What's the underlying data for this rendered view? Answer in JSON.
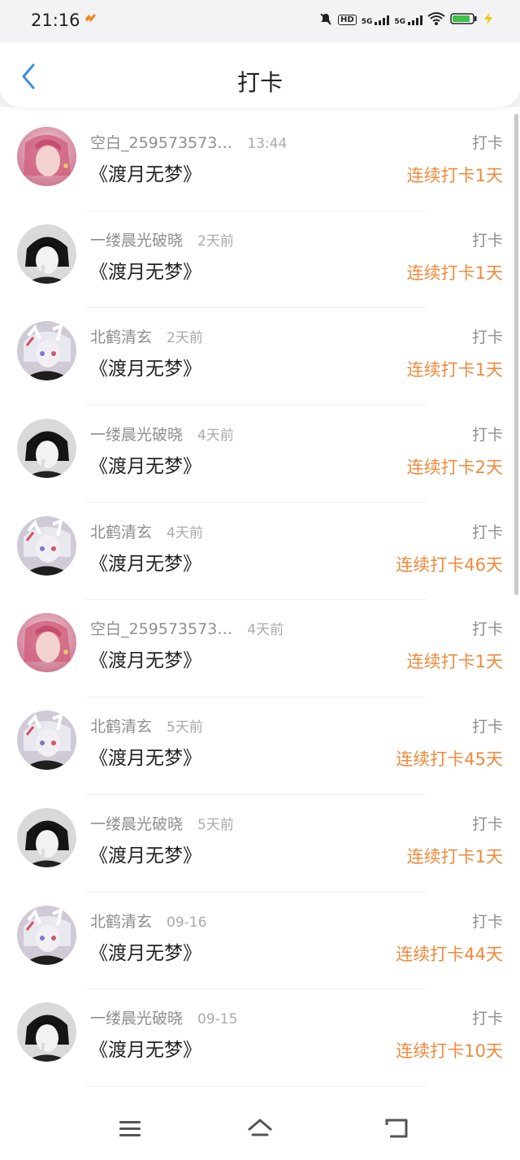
{
  "status_bar": {
    "time": "21:16",
    "network_label": "HD",
    "signal_1": "5G",
    "signal_2": "5G"
  },
  "header": {
    "title": "打卡",
    "back_icon": "chevron-left-icon"
  },
  "items": [
    {
      "name": "空白_259573573…",
      "time": "13:44",
      "book": "《渡月无梦》",
      "action": "打卡",
      "streak": "连续打卡1天",
      "avatar": "pink"
    },
    {
      "name": "一缕晨光破晓",
      "time": "2天前",
      "book": "《渡月无梦》",
      "action": "打卡",
      "streak": "连续打卡1天",
      "avatar": "dark"
    },
    {
      "name": "北鹤清玄",
      "time": "2天前",
      "book": "《渡月无梦》",
      "action": "打卡",
      "streak": "连续打卡1天",
      "avatar": "white"
    },
    {
      "name": "一缕晨光破晓",
      "time": "4天前",
      "book": "《渡月无梦》",
      "action": "打卡",
      "streak": "连续打卡2天",
      "avatar": "dark"
    },
    {
      "name": "北鹤清玄",
      "time": "4天前",
      "book": "《渡月无梦》",
      "action": "打卡",
      "streak": "连续打卡46天",
      "avatar": "white"
    },
    {
      "name": "空白_259573573…",
      "time": "4天前",
      "book": "《渡月无梦》",
      "action": "打卡",
      "streak": "连续打卡1天",
      "avatar": "pink"
    },
    {
      "name": "北鹤清玄",
      "time": "5天前",
      "book": "《渡月无梦》",
      "action": "打卡",
      "streak": "连续打卡45天",
      "avatar": "white"
    },
    {
      "name": "一缕晨光破晓",
      "time": "5天前",
      "book": "《渡月无梦》",
      "action": "打卡",
      "streak": "连续打卡1天",
      "avatar": "dark"
    },
    {
      "name": "北鹤清玄",
      "time": "09-16",
      "book": "《渡月无梦》",
      "action": "打卡",
      "streak": "连续打卡44天",
      "avatar": "white"
    },
    {
      "name": "一缕晨光破晓",
      "time": "09-15",
      "book": "《渡月无梦》",
      "action": "打卡",
      "streak": "连续打卡10天",
      "avatar": "dark"
    }
  ],
  "colors": {
    "accent_orange": "#ef8a3c",
    "back_blue": "#3b8fe6"
  },
  "nav": {
    "menu_icon": "menu-icon",
    "home_icon": "home-icon",
    "back_icon": "return-icon"
  }
}
